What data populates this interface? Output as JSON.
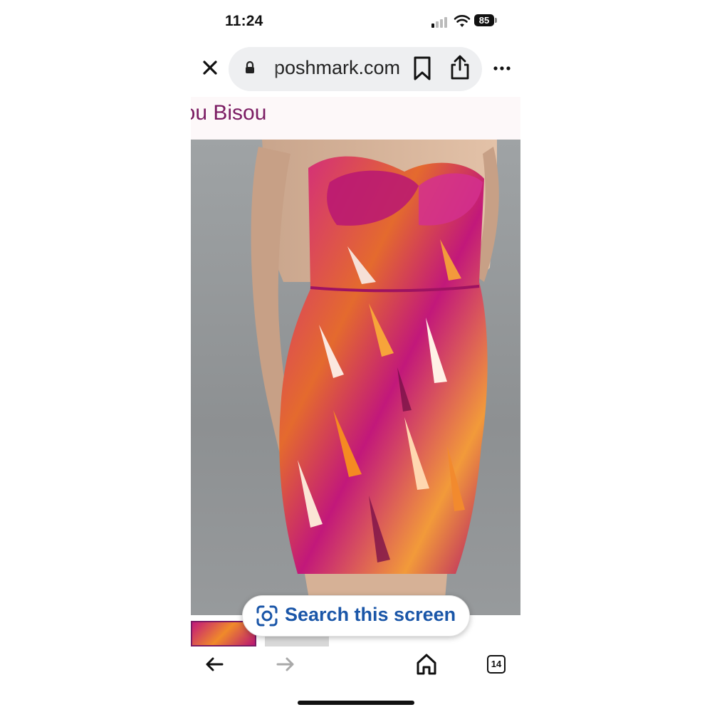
{
  "status_bar": {
    "time": "11:24",
    "battery": "85"
  },
  "browser": {
    "url": "poshmark.com"
  },
  "page": {
    "brand": "Bisou Bisou"
  },
  "lens_chip": {
    "label": "Search this screen"
  },
  "tab_switcher": {
    "count": "14"
  },
  "colors": {
    "brand": "#7b1c63",
    "lens_text": "#1a56a8",
    "dress_magenta": "#c2187a",
    "dress_orange": "#f08a2a"
  }
}
